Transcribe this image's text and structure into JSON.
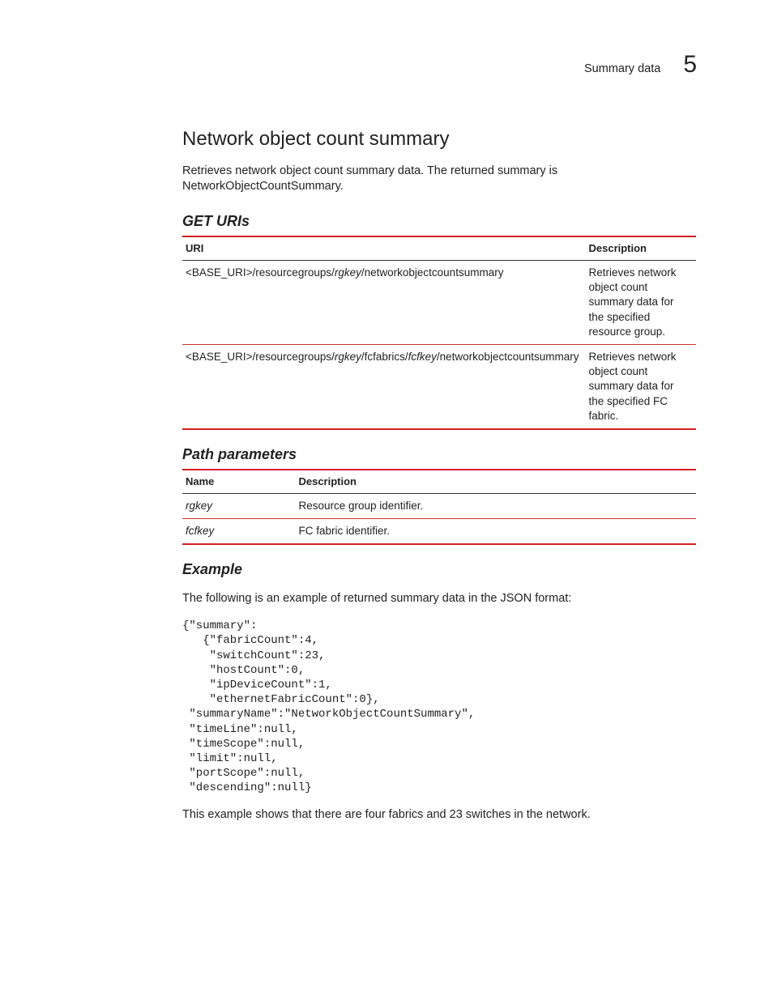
{
  "header": {
    "running_title": "Summary data",
    "chapter_number": "5"
  },
  "section": {
    "title": "Network object count summary",
    "intro": "Retrieves network object count summary data. The returned summary is NetworkObjectCountSummary."
  },
  "get_uris": {
    "heading": "GET URIs",
    "columns": {
      "uri": "URI",
      "description": "Description"
    },
    "rows": [
      {
        "uri_pre": "<BASE_URI>/resourcegroups/",
        "uri_param1": "rgkey",
        "uri_post1": "/networkobjectcountsummary",
        "description": "Retrieves network object count summary data for the specified resource group."
      },
      {
        "uri_pre": "<BASE_URI>/resourcegroups/",
        "uri_param1": "rgkey",
        "uri_mid": "/fcfabrics/",
        "uri_param2": "fcfkey",
        "uri_post1": "/networkobjectcountsummary",
        "description": "Retrieves network object count summary data for the specified FC fabric."
      }
    ]
  },
  "path_params": {
    "heading": "Path parameters",
    "columns": {
      "name": "Name",
      "description": "Description"
    },
    "rows": [
      {
        "name": "rgkey",
        "description": "Resource group identifier."
      },
      {
        "name": "fcfkey",
        "description": "FC fabric identifier."
      }
    ]
  },
  "example": {
    "heading": "Example",
    "lead": "The following is an example of returned summary data in the JSON format:",
    "code": "{\"summary\":\n   {\"fabricCount\":4,\n    \"switchCount\":23,\n    \"hostCount\":0,\n    \"ipDeviceCount\":1,\n    \"ethernetFabricCount\":0},\n \"summaryName\":\"NetworkObjectCountSummary\",\n \"timeLine\":null,\n \"timeScope\":null,\n \"limit\":null,\n \"portScope\":null,\n \"descending\":null}",
    "note": "This example shows that there are four fabrics and 23 switches in the network."
  }
}
